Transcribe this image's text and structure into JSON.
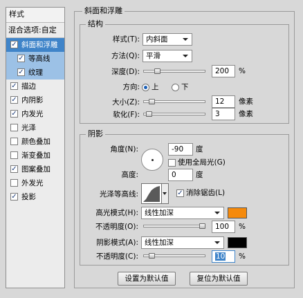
{
  "left_panel": {
    "header": "样式",
    "blend_options": "混合选项:自定",
    "items": [
      {
        "label": "斜面和浮雕",
        "checked": true,
        "level": 0,
        "state": "selected"
      },
      {
        "label": "等高线",
        "checked": true,
        "level": 1,
        "state": "subselected"
      },
      {
        "label": "纹理",
        "checked": true,
        "level": 1,
        "state": "subselected"
      },
      {
        "label": "描边",
        "checked": true,
        "level": 0,
        "state": ""
      },
      {
        "label": "内阴影",
        "checked": true,
        "level": 0,
        "state": ""
      },
      {
        "label": "内发光",
        "checked": true,
        "level": 0,
        "state": ""
      },
      {
        "label": "光泽",
        "checked": false,
        "level": 0,
        "state": ""
      },
      {
        "label": "颜色叠加",
        "checked": false,
        "level": 0,
        "state": ""
      },
      {
        "label": "渐变叠加",
        "checked": false,
        "level": 0,
        "state": ""
      },
      {
        "label": "图案叠加",
        "checked": true,
        "level": 0,
        "state": ""
      },
      {
        "label": "外发光",
        "checked": false,
        "level": 0,
        "state": ""
      },
      {
        "label": "投影",
        "checked": true,
        "level": 0,
        "state": ""
      }
    ]
  },
  "bevel": {
    "title": "斜面和浮雕",
    "structure": {
      "title": "结构",
      "style_label": "样式(T):",
      "style_value": "内斜面",
      "technique_label": "方法(Q):",
      "technique_value": "平滑",
      "depth_label": "深度(D):",
      "depth_value": "200",
      "depth_unit": "%",
      "depth_slider_fraction": 0.2,
      "direction_label": "方向:",
      "direction_up": "上",
      "direction_down": "下",
      "direction_selected": "up",
      "size_label": "大小(Z):",
      "size_value": "12",
      "size_unit": "像素",
      "size_slider_fraction": 0.1,
      "soften_label": "软化(F):",
      "soften_value": "3",
      "soften_unit": "像素",
      "soften_slider_fraction": 0.05
    },
    "shading": {
      "title": "阴影",
      "angle_label": "角度(N):",
      "angle_value": "-90",
      "angle_unit": "度",
      "global_light_label": "使用全局光(G)",
      "global_light_checked": false,
      "altitude_label": "高度:",
      "altitude_value": "0",
      "altitude_unit": "度",
      "gloss_contour_label": "光泽等高线:",
      "anti_aliased_label": "消除锯齿(L)",
      "anti_aliased_checked": true,
      "highlight_mode_label": "高光模式(H):",
      "highlight_mode_value": "线性加深",
      "highlight_color": "#f58a0c",
      "highlight_opacity_label": "不透明度(O):",
      "highlight_opacity_value": "100",
      "highlight_opacity_unit": "%",
      "highlight_opacity_fraction": 1.0,
      "shadow_mode_label": "阴影模式(A):",
      "shadow_mode_value": "线性加深",
      "shadow_color": "#000000",
      "shadow_opacity_label": "不透明度(C):",
      "shadow_opacity_value": "10",
      "shadow_opacity_unit": "%",
      "shadow_opacity_fraction": 0.1
    }
  },
  "buttons": {
    "make_default": "设置为默认值",
    "reset_default": "复位为默认值"
  },
  "icons": {
    "checkbox_check": "✓"
  }
}
